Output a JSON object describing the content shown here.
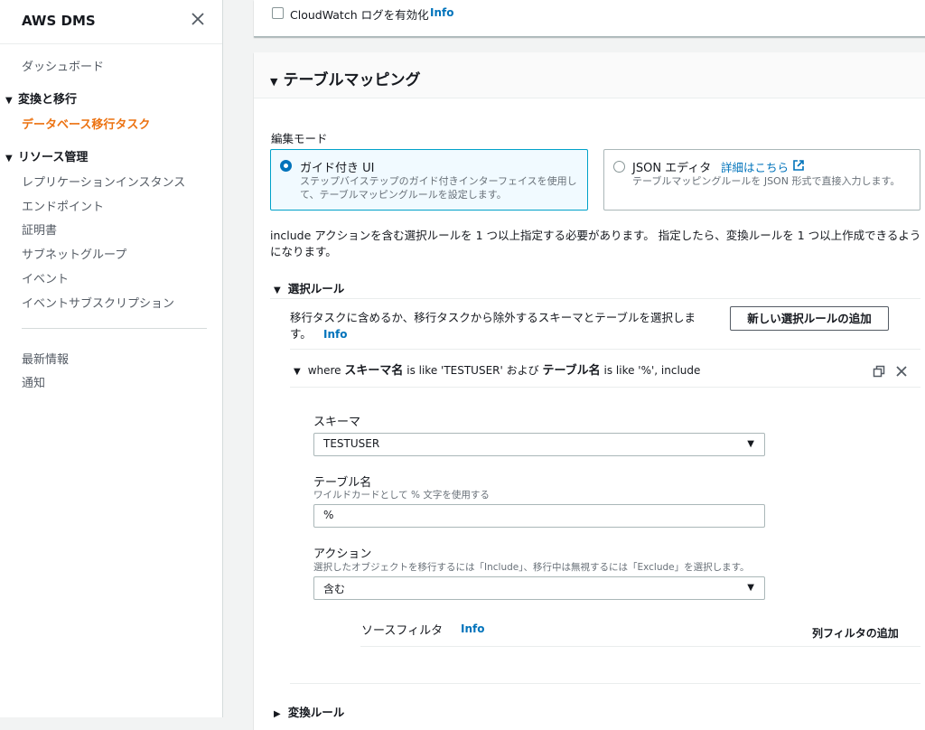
{
  "sidebar": {
    "title": "AWS DMS",
    "dashboard": "ダッシュボード",
    "section_migrate": "変換と移行",
    "db_migration_tasks": "データベース移行タスク",
    "section_resources": "リソース管理",
    "resource_items": [
      "レプリケーションインスタンス",
      "エンドポイント",
      "証明書",
      "サブネットグループ",
      "イベント",
      "イベントサブスクリプション"
    ],
    "whats_new": "最新情報",
    "notifications": "通知"
  },
  "top_panel": {
    "cloudwatch_label": "CloudWatch ログを有効化",
    "info": "Info"
  },
  "table_mapping": {
    "title": "テーブルマッピング",
    "edit_mode_label": "編集モード",
    "guided": {
      "title": "ガイド付き UI",
      "desc_line1": "ステップバイステップのガイド付きインターフェイスを使用し",
      "desc_line2": "て、テーブルマッピングルールを設定します。"
    },
    "json": {
      "title": "JSON エディタ",
      "link": "詳細はこちら",
      "desc": "テーブルマッピングルールを JSON 形式で直接入力します。"
    },
    "notice_line1": "include アクションを含む選択ルールを 1 つ以上指定する必要があります。 指定したら、変換ルールを 1 つ以上作成できるよう",
    "notice_line2": "になります。",
    "selection_rules": {
      "title": "選択ルール",
      "desc_line1": "移行タスクに含めるか、移行タスクから除外するスキーマとテーブルを選択しま",
      "desc_line2": "す。",
      "info": "Info",
      "add_button": "新しい選択ルールの追加",
      "rule": {
        "where": "where",
        "schema_word": "スキーマ名",
        "is_like_1": "is like 'TESTUSER' および",
        "table_word": "テーブル名",
        "is_like_2": "is like '%', include"
      },
      "schema_label": "スキーマ",
      "schema_value": "TESTUSER",
      "table_label": "テーブル名",
      "table_hint": "ワイルドカードとして % 文字を使用する",
      "table_value": "%",
      "action_label": "アクション",
      "action_hint": "選択したオブジェクトを移行するには「Include」、移行中は無視するには「Exclude」を選択します。",
      "action_value": "含む",
      "source_filter": "ソースフィルタ",
      "source_filter_info": "Info",
      "add_column_filter": "列フィルタの追加"
    },
    "transform_rules": "変換ルール"
  },
  "colors": {
    "accent": "#ec7211",
    "link": "#0073bb",
    "selected_border": "#00a1c9"
  }
}
